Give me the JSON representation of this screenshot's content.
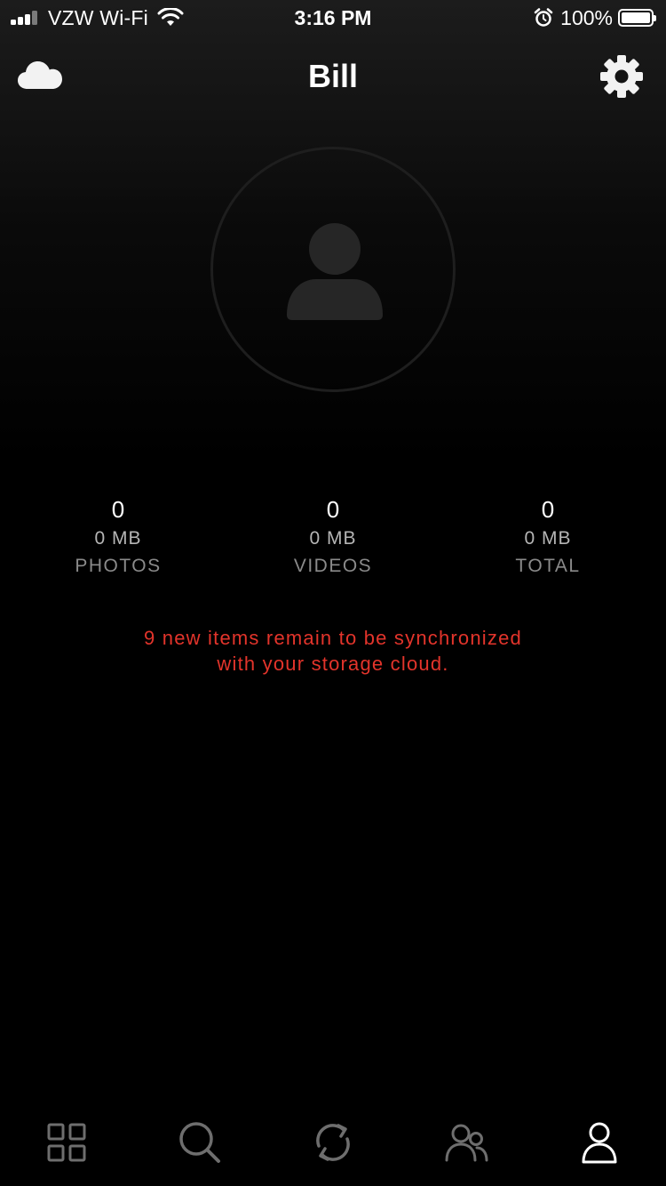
{
  "status_bar": {
    "carrier": "VZW Wi-Fi",
    "time": "3:16 PM",
    "battery_percent": "100%",
    "signal_bars_active": 3,
    "icons": [
      "signal-icon",
      "wifi-icon",
      "alarm-icon",
      "battery-icon"
    ]
  },
  "header": {
    "title": "Bill",
    "left_icon": "cloud-icon",
    "right_icon": "gear-icon"
  },
  "profile": {
    "avatar_icon": "user-placeholder-icon"
  },
  "stats": {
    "photos": {
      "count": "0",
      "size": "0 MB",
      "label": "PHOTOS"
    },
    "videos": {
      "count": "0",
      "size": "0 MB",
      "label": "VIDEOS"
    },
    "total": {
      "count": "0",
      "size": "0 MB",
      "label": "TOTAL"
    }
  },
  "sync": {
    "line1": "9 new items remain to be synchronized",
    "line2": "with your storage cloud."
  },
  "tab_bar": {
    "items": [
      {
        "icon": "grid-icon",
        "active": false
      },
      {
        "icon": "search-icon",
        "active": false
      },
      {
        "icon": "sync-icon",
        "active": false
      },
      {
        "icon": "people-icon",
        "active": false
      },
      {
        "icon": "profile-icon",
        "active": true
      }
    ]
  },
  "colors": {
    "background": "#000000",
    "accent_warning": "#e3342b",
    "icon_inactive": "#6e6e6e",
    "icon_active": "#ffffff"
  }
}
